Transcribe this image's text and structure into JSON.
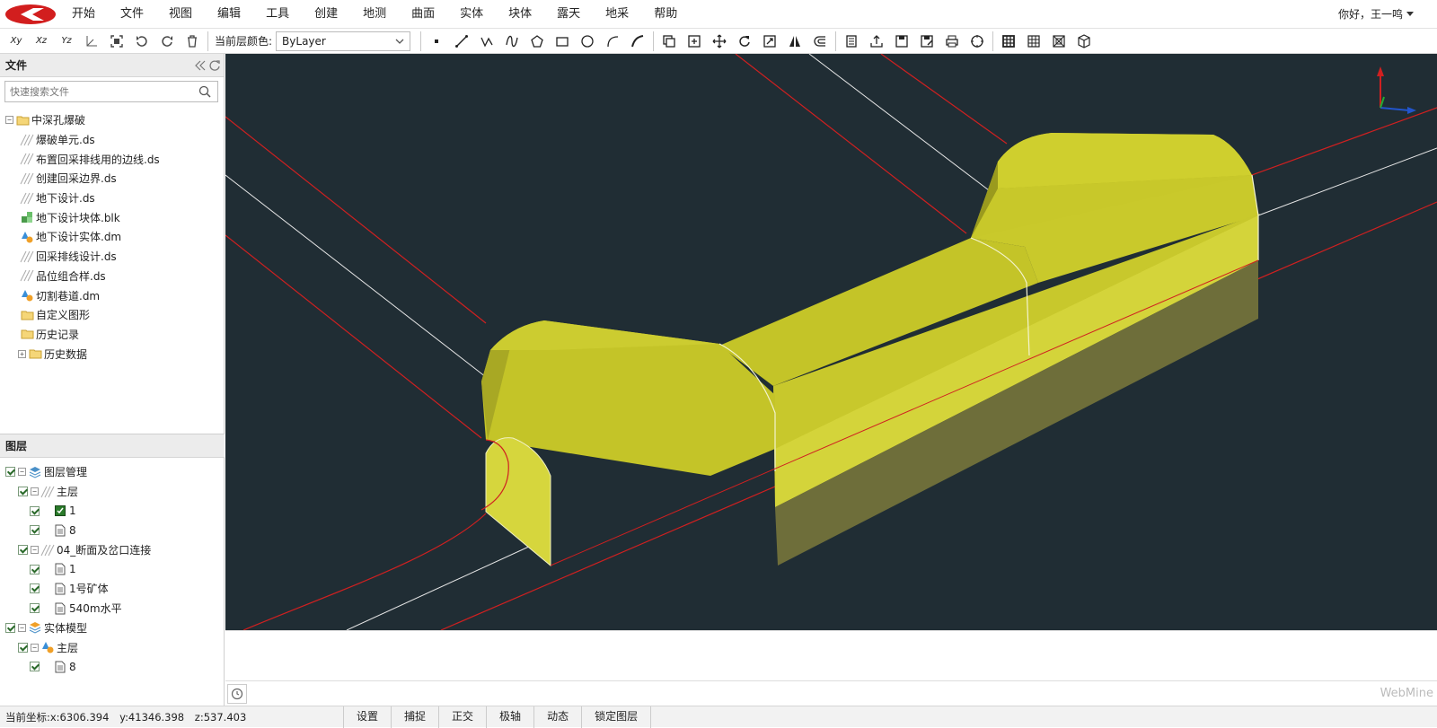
{
  "app": {
    "brand": "WebMine"
  },
  "menu": {
    "items": [
      "开始",
      "文件",
      "视图",
      "编辑",
      "工具",
      "创建",
      "地测",
      "曲面",
      "实体",
      "块体",
      "露天",
      "地采",
      "帮助"
    ],
    "greeting": "你好，王一鸣"
  },
  "toolbar": {
    "layer_color_label": "当前层颜色:",
    "layer_color_value": "ByLayer",
    "view_buttons": [
      {
        "label": "Xy",
        "icon": "xy-plane-icon"
      },
      {
        "label": "Xz",
        "icon": "xz-plane-icon"
      },
      {
        "label": "Yz",
        "icon": "yz-plane-icon"
      }
    ]
  },
  "files_panel": {
    "title": "文件",
    "search_placeholder": "快速搜索文件",
    "root": "中深孔爆破",
    "items": [
      {
        "label": "爆破单元.ds",
        "icon": "line-file-icon"
      },
      {
        "label": "布置回采排线用的边线.ds",
        "icon": "line-file-icon"
      },
      {
        "label": "创建回采边界.ds",
        "icon": "line-file-icon"
      },
      {
        "label": "地下设计.ds",
        "icon": "line-file-icon"
      },
      {
        "label": "地下设计块体.blk",
        "icon": "block-file-icon"
      },
      {
        "label": "地下设计实体.dm",
        "icon": "solid-file-icon"
      },
      {
        "label": "回采排线设计.ds",
        "icon": "line-file-icon"
      },
      {
        "label": "品位组合样.ds",
        "icon": "line-file-icon"
      },
      {
        "label": "切割巷道.dm",
        "icon": "solid-file-icon"
      },
      {
        "label": "自定义图形",
        "icon": "folder-icon"
      },
      {
        "label": "历史记录",
        "icon": "folder-icon"
      },
      {
        "label": "历史数据",
        "icon": "folder-icon"
      }
    ]
  },
  "layers_panel": {
    "title": "图层",
    "rows": [
      {
        "label": "图层管理"
      },
      {
        "label": "主层"
      },
      {
        "label": "1"
      },
      {
        "label": "8"
      },
      {
        "label": "04_断面及岔口连接"
      },
      {
        "label": "1"
      },
      {
        "label": "1号矿体"
      },
      {
        "label": "540m水平"
      },
      {
        "label": "实体模型"
      },
      {
        "label": "主层"
      },
      {
        "label": "8"
      }
    ]
  },
  "viewport": {
    "background": "#202d34",
    "solid_color": "#d4d42a",
    "line_red": "#d02020",
    "line_white": "#e6e6e6"
  },
  "status": {
    "coord_label": "当前坐标:",
    "x": "x:6306.394",
    "y": "y:41346.398",
    "z": "z:537.403",
    "buttons": [
      "设置",
      "捕捉",
      "正交",
      "极轴",
      "动态",
      "锁定图层"
    ]
  }
}
